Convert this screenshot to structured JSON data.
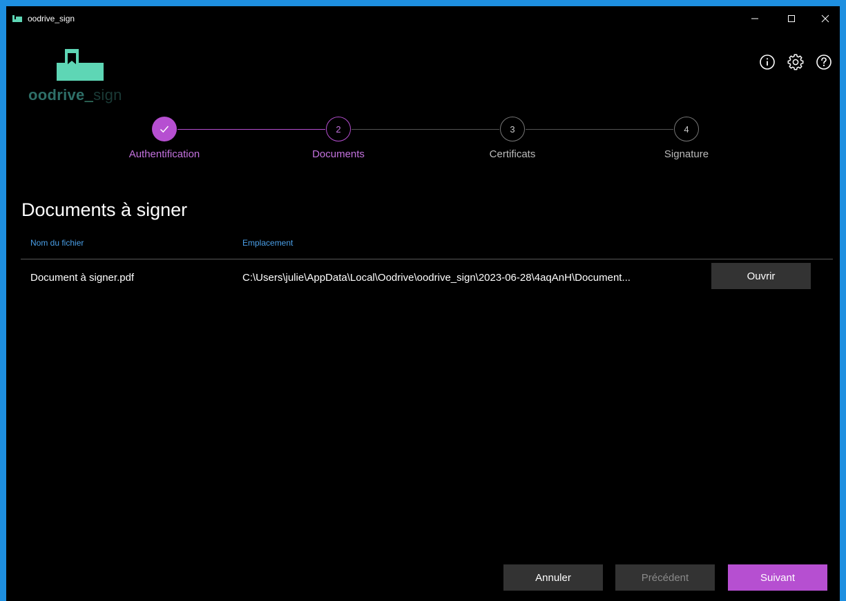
{
  "window": {
    "title": "oodrive_sign",
    "controls": {
      "minimize": "minimize-icon",
      "maximize": "maximize-icon",
      "close": "close-icon"
    }
  },
  "logo": {
    "brand": "oodrive",
    "underscore": "_",
    "suffix": "sign"
  },
  "header_icons": [
    "info-icon",
    "gear-icon",
    "help-icon"
  ],
  "stepper": {
    "steps": [
      {
        "number": "✓",
        "label": "Authentification",
        "state": "completed"
      },
      {
        "number": "2",
        "label": "Documents",
        "state": "active"
      },
      {
        "number": "3",
        "label": "Certificats",
        "state": "pending"
      },
      {
        "number": "4",
        "label": "Signature",
        "state": "pending"
      }
    ]
  },
  "main": {
    "title": "Documents à signer",
    "columns": {
      "name": "Nom du fichier",
      "location": "Emplacement"
    },
    "rows": [
      {
        "name": "Document à signer.pdf",
        "location": "C:\\Users\\julie\\AppData\\Local\\Oodrive\\oodrive_sign\\2023-06-28\\4aqAnH\\Document...",
        "action": "Ouvrir"
      }
    ]
  },
  "footer": {
    "cancel": "Annuler",
    "previous": "Précédent",
    "next": "Suivant"
  },
  "colors": {
    "accent": "#b64fd1",
    "active_text": "#c472df",
    "logo_green": "#5ed6b5",
    "header_blue": "#4a9fe8",
    "button_gray": "#333333",
    "window_border": "#1e8fe0"
  }
}
